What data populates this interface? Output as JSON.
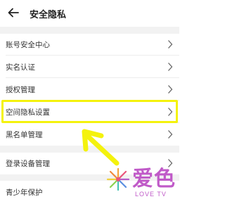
{
  "header": {
    "title": "安全隐私",
    "back_icon": "back-arrow-icon"
  },
  "sections": [
    {
      "items": [
        {
          "label": "账号安全中心",
          "icon": "chevron-right-icon"
        },
        {
          "label": "实名认证",
          "icon": "chevron-right-icon"
        },
        {
          "label": "授权管理",
          "icon": "chevron-right-icon"
        },
        {
          "label": "空间隐私设置",
          "icon": "chevron-right-icon"
        },
        {
          "label": "黑名单管理",
          "icon": "chevron-right-icon"
        }
      ]
    },
    {
      "items": [
        {
          "label": "登录设备管理",
          "icon": "chevron-right-icon"
        }
      ]
    },
    {
      "items": [
        {
          "label": "青少年保护"
        }
      ]
    }
  ],
  "annotation": {
    "highlight_color": "#f4f20d",
    "highlighted_item": "空间隐私设置"
  },
  "watermark": {
    "text": "爱色",
    "subtext": "LOVE TV",
    "color": "#c05ac8"
  }
}
